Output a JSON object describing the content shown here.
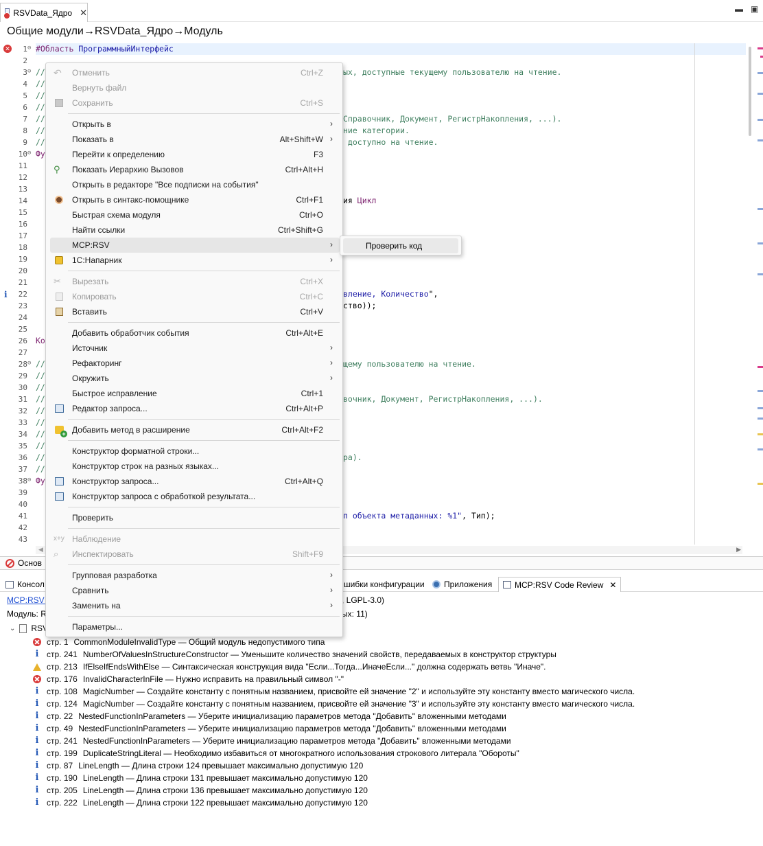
{
  "editor": {
    "tab_label": "RSVData_Ядро",
    "tab_close": "✕",
    "title": "Общие модули→RSVData_Ядро→Модуль"
  },
  "code_lines": [
    {
      "n": "1",
      "text": "#Область ПрограммныйИнтерфейс"
    },
    {
      "n": "2",
      "text": ""
    },
    {
      "n": "3",
      "text": "//"
    },
    {
      "n": "4",
      "text": "//"
    },
    {
      "n": "5",
      "text": "//"
    },
    {
      "n": "6",
      "text": "//"
    },
    {
      "n": "7",
      "text": "//"
    },
    {
      "n": "8",
      "text": "//"
    },
    {
      "n": "9",
      "text": "//"
    },
    {
      "n": "10",
      "text": "Фу"
    },
    {
      "n": "11",
      "text": ""
    },
    {
      "n": "12",
      "text": ""
    },
    {
      "n": "13",
      "text": ""
    },
    {
      "n": "14",
      "text": ""
    },
    {
      "n": "15",
      "text": ""
    },
    {
      "n": "16",
      "text": ""
    },
    {
      "n": "17",
      "text": ""
    },
    {
      "n": "18",
      "text": ""
    },
    {
      "n": "19",
      "text": ""
    },
    {
      "n": "20",
      "text": ""
    },
    {
      "n": "21",
      "text": ""
    },
    {
      "n": "22",
      "text": ""
    },
    {
      "n": "23",
      "text": ""
    },
    {
      "n": "24",
      "text": ""
    },
    {
      "n": "25",
      "text": ""
    },
    {
      "n": "26",
      "text": "Ко"
    },
    {
      "n": "27",
      "text": ""
    },
    {
      "n": "28",
      "text": "//"
    },
    {
      "n": "29",
      "text": "//"
    },
    {
      "n": "30",
      "text": "//"
    },
    {
      "n": "31",
      "text": "//"
    },
    {
      "n": "32",
      "text": "//"
    },
    {
      "n": "33",
      "text": "//"
    },
    {
      "n": "34",
      "text": "//"
    },
    {
      "n": "35",
      "text": "//"
    },
    {
      "n": "36",
      "text": "//"
    },
    {
      "n": "37",
      "text": "//"
    },
    {
      "n": "38",
      "text": "Фу"
    },
    {
      "n": "39",
      "text": ""
    },
    {
      "n": "40",
      "text": ""
    },
    {
      "n": "41",
      "text": ""
    },
    {
      "n": "42",
      "text": ""
    },
    {
      "n": "43",
      "text": ""
    }
  ],
  "code_fragments": {
    "l3": "ых, доступные текущему пользователю на чтение.",
    "l7": "Справочник, Документ, РегистрНакопления, ...).",
    "l8": "ние категории.",
    "l9": " доступно на чтение.",
    "l14_a": "ия ",
    "l14_b": "Цикл",
    "l22_a": "вление, Количество",
    "l22_b": "\",",
    "l23": "ство));",
    "l28": "щему пользователю на чтение.",
    "l31": "вочник, Документ, РегистрНакопления, ...).",
    "l36": "ра).",
    "l41_a": "п объекта метаданных: %1\"",
    "l41_b": ", Тип);"
  },
  "context_menu": {
    "items": [
      {
        "label": "Отменить",
        "shortcut": "Ctrl+Z",
        "disabled": true,
        "icon": "undo-icon"
      },
      {
        "label": "Вернуть файл",
        "shortcut": "",
        "disabled": true
      },
      {
        "label": "Сохранить",
        "shortcut": "Ctrl+S",
        "disabled": true,
        "icon": "save-icon"
      },
      {
        "label": "Открыть в",
        "shortcut": "",
        "submenu": true
      },
      {
        "label": "Показать в",
        "shortcut": "Alt+Shift+W",
        "submenu": true
      },
      {
        "label": "Перейти к определению",
        "shortcut": "F3"
      },
      {
        "label": "Показать Иерархию Вызовов",
        "shortcut": "Ctrl+Alt+H",
        "icon": "call-hierarchy-icon"
      },
      {
        "label": "Открыть в редакторе \"Все подписки на события\"",
        "shortcut": ""
      },
      {
        "label": "Открыть в синтакс-помощнике",
        "shortcut": "Ctrl+F1",
        "icon": "syntax-helper-icon"
      },
      {
        "label": "Быстрая схема модуля",
        "shortcut": "Ctrl+O"
      },
      {
        "label": "Найти ссылки",
        "shortcut": "Ctrl+Shift+G"
      },
      {
        "label": "MCP:RSV",
        "shortcut": "",
        "submenu": true
      },
      {
        "label": "1С:Напарник",
        "shortcut": "",
        "submenu": true,
        "icon": "assistant-icon"
      },
      {
        "label": "Вырезать",
        "shortcut": "Ctrl+X",
        "disabled": true,
        "icon": "cut-icon"
      },
      {
        "label": "Копировать",
        "shortcut": "Ctrl+C",
        "disabled": true,
        "icon": "copy-icon"
      },
      {
        "label": "Вставить",
        "shortcut": "Ctrl+V",
        "icon": "paste-icon"
      },
      {
        "label": "Добавить обработчик события",
        "shortcut": "Ctrl+Alt+E"
      },
      {
        "label": "Источник",
        "shortcut": "",
        "submenu": true
      },
      {
        "label": "Рефакторинг",
        "shortcut": "",
        "submenu": true
      },
      {
        "label": "Окружить",
        "shortcut": "",
        "submenu": true
      },
      {
        "label": "Быстрое исправление",
        "shortcut": "Ctrl+1"
      },
      {
        "label": "Редактор запроса...",
        "shortcut": "Ctrl+Alt+P",
        "icon": "query-editor-icon"
      },
      {
        "label": "Добавить метод в расширение",
        "shortcut": "Ctrl+Alt+F2",
        "icon": "add-method-icon"
      },
      {
        "label": "Конструктор форматной строки...",
        "shortcut": ""
      },
      {
        "label": "Конструктор строк на разных языках...",
        "shortcut": ""
      },
      {
        "label": "Конструктор запроса...",
        "shortcut": "Ctrl+Alt+Q",
        "icon": "query-builder-icon"
      },
      {
        "label": "Конструктор запроса с обработкой результата...",
        "shortcut": "",
        "icon": "query-builder-result-icon"
      },
      {
        "label": "Проверить",
        "shortcut": ""
      },
      {
        "label": "Наблюдение",
        "shortcut": "",
        "disabled": true,
        "icon": "watch-icon"
      },
      {
        "label": "Инспектировать",
        "shortcut": "Shift+F9",
        "disabled": true,
        "icon": "inspect-icon"
      },
      {
        "label": "Групповая разработка",
        "shortcut": "",
        "submenu": true
      },
      {
        "label": "Сравнить",
        "shortcut": "",
        "submenu": true
      },
      {
        "label": "Заменить на",
        "shortcut": "",
        "submenu": true
      },
      {
        "label": "Параметры...",
        "shortcut": ""
      }
    ],
    "submenu_arrow": "›",
    "mcp_submenu": {
      "item": "Проверить код"
    }
  },
  "status_bar": {
    "text": "Основ"
  },
  "views": {
    "tabs": [
      {
        "label": "Консол"
      },
      {
        "label": "шибки конфигурации"
      },
      {
        "label": "Приложения"
      },
      {
        "label": "MCP:RSV Code Review"
      }
    ],
    "close_glyph": "✕"
  },
  "review": {
    "link_text": "MCP:RSV C",
    "header_tail": ", LGPL-3.0)",
    "module_label": "Модуль: R",
    "module_tail": "ых: 11)",
    "root_label": "RSV",
    "issues": [
      {
        "type": "error",
        "loc": "стр. 1",
        "text": "CommonModuleInvalidType — Общий модуль недопустимого типа"
      },
      {
        "type": "info",
        "loc": "стр. 241",
        "text": "NumberOfValuesInStructureConstructor — Уменьшите количество значений свойств, передаваемых в конструктор структуры"
      },
      {
        "type": "warning",
        "loc": "стр. 213",
        "text": "IfElseIfEndsWithElse — Синтаксическая конструкция вида \"Если...Тогда...ИначеЕсли...\" должна содержать ветвь \"Иначе\"."
      },
      {
        "type": "error",
        "loc": "стр. 176",
        "text": "InvalidCharacterInFile — Нужно исправить на правильный символ \"-\""
      },
      {
        "type": "info",
        "loc": "стр. 108",
        "text": "MagicNumber — Создайте константу с понятным названием, присвойте ей значение \"2\" и используйте эту константу вместо магического числа."
      },
      {
        "type": "info",
        "loc": "стр. 124",
        "text": "MagicNumber — Создайте константу с понятным названием, присвойте ей значение \"3\" и используйте эту константу вместо магического числа."
      },
      {
        "type": "info",
        "loc": "стр. 22",
        "text": "NestedFunctionInParameters — Уберите инициализацию параметров метода \"Добавить\" вложенными методами"
      },
      {
        "type": "info",
        "loc": "стр. 49",
        "text": "NestedFunctionInParameters — Уберите инициализацию параметров метода \"Добавить\" вложенными методами"
      },
      {
        "type": "info",
        "loc": "стр. 241",
        "text": "NestedFunctionInParameters — Уберите инициализацию параметров метода \"Добавить\" вложенными методами"
      },
      {
        "type": "info",
        "loc": "стр. 199",
        "text": "DuplicateStringLiteral — Необходимо избавиться от многократного использования строкового литерала \"Обороты\""
      },
      {
        "type": "info",
        "loc": "стр. 87",
        "text": "LineLength — Длина строки 124 превышает максимально допустимую 120"
      },
      {
        "type": "info",
        "loc": "стр. 190",
        "text": "LineLength — Длина строки 131 превышает максимально допустимую 120"
      },
      {
        "type": "info",
        "loc": "стр. 205",
        "text": "LineLength — Длина строки 136 превышает максимально допустимую 120"
      },
      {
        "type": "info",
        "loc": "стр. 222",
        "text": "LineLength — Длина строки 122 превышает максимально допустимую 120"
      }
    ]
  },
  "colors": {
    "keyword": "#7a1e6c",
    "identifier": "#1a1aa6",
    "comment": "#3f7f5f",
    "error": "#d93a3a",
    "info": "#2458b6",
    "warning": "#e8b22b"
  }
}
